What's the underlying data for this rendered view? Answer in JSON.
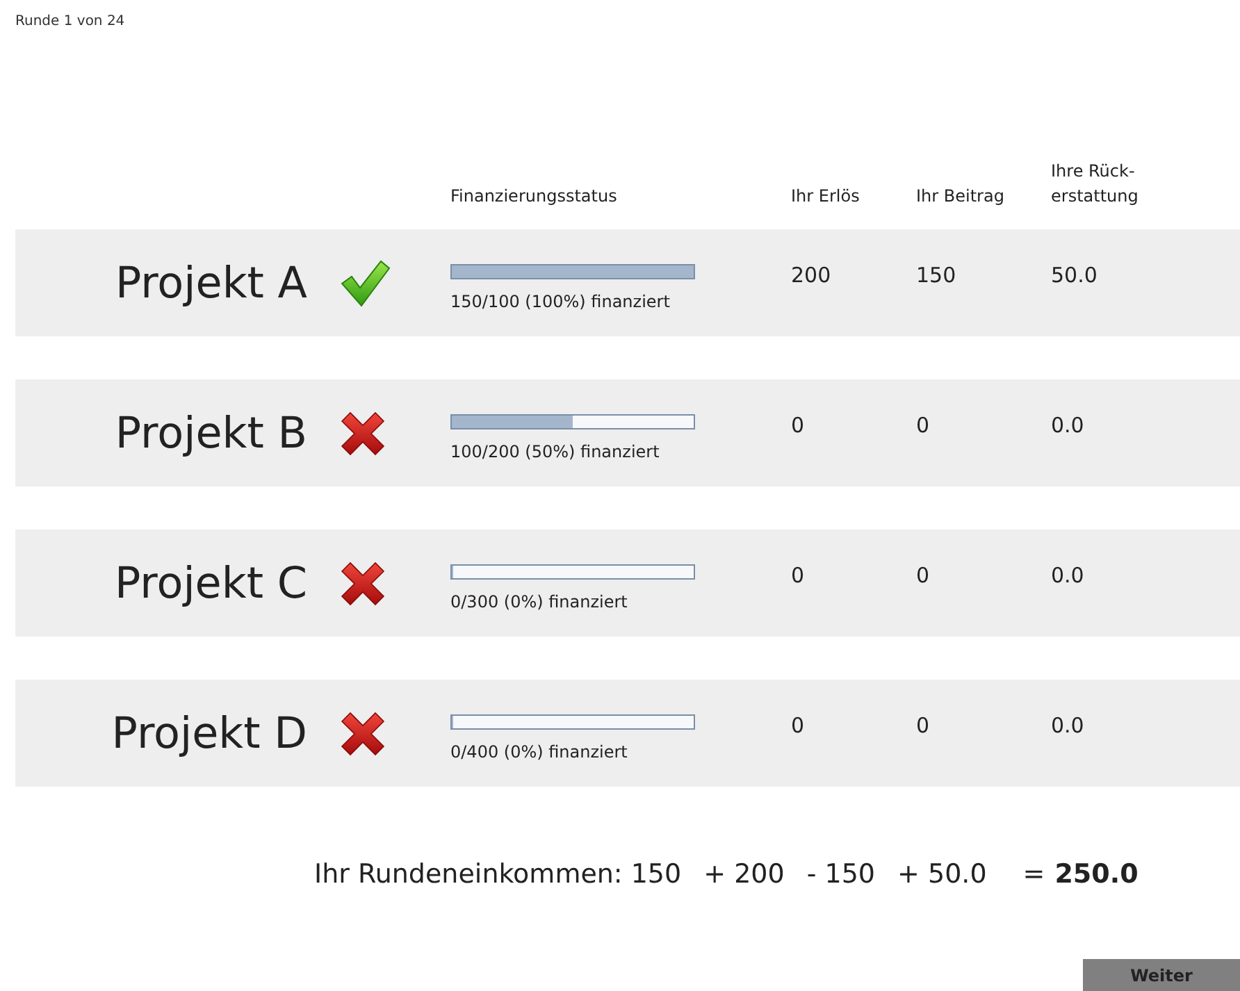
{
  "round_label": "Runde 1 von 24",
  "columns": {
    "status": "Finanzierungsstatus",
    "revenue": "Ihr Erlös",
    "contribution": "Ihr Beitrag",
    "refund": [
      "Ihre Rück-",
      "erstattung"
    ]
  },
  "projects": [
    {
      "name": "Projekt A",
      "funded": true,
      "level": 1.0,
      "status_text": "150/100 (100%) finanziert",
      "revenue": "200",
      "contribution": "150",
      "refund": "50.0"
    },
    {
      "name": "Projekt B",
      "funded": false,
      "level": 0.5,
      "status_text": "100/200 (50%) finanziert",
      "revenue": "0",
      "contribution": "0",
      "refund": "0.0"
    },
    {
      "name": "Projekt C",
      "funded": false,
      "level": 0.0,
      "status_text": "0/300 (0%) finanziert",
      "revenue": "0",
      "contribution": "0",
      "refund": "0.0"
    },
    {
      "name": "Projekt D",
      "funded": false,
      "level": 0.0,
      "status_text": "0/400 (0%) finanziert",
      "revenue": "0",
      "contribution": "0",
      "refund": "0.0"
    }
  ],
  "income": {
    "label": "Ihr Rundeneinkommen:",
    "terms": [
      "150",
      "+ 200",
      "- 150",
      "+ 50.0"
    ],
    "total_sign": "=",
    "total": "250.0"
  },
  "next_button": "Weiter"
}
